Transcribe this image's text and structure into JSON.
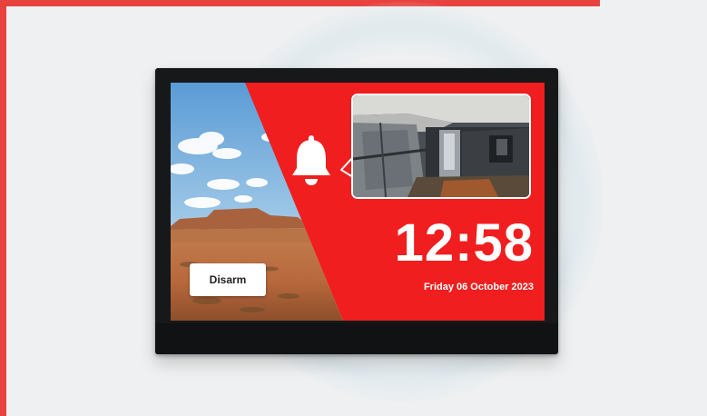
{
  "panel": {
    "time": "12:58",
    "date": "Friday 06 October 2023",
    "disarm_label": "Disarm"
  },
  "icons": {
    "alarm": "bell-icon",
    "camera": "camera-feed-thumbnail"
  },
  "colors": {
    "alert_red": "#f01e1e",
    "frame_accent": "#e8423f",
    "device_bezel": "#17181a",
    "background": "#eef0f1"
  }
}
